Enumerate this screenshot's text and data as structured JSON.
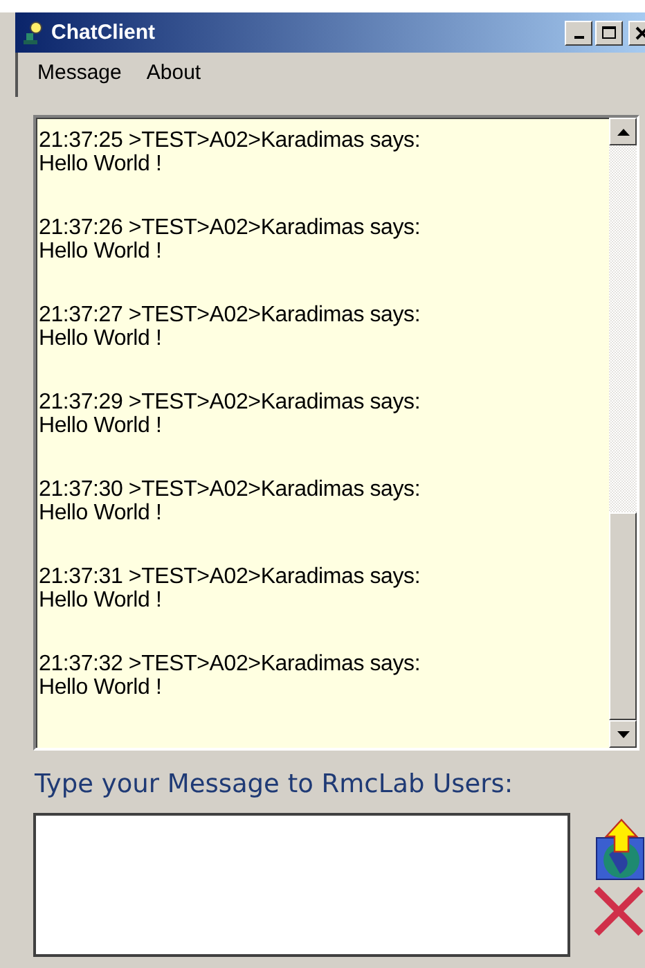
{
  "window": {
    "title": "ChatClient"
  },
  "menu": [
    "Message",
    "About"
  ],
  "messages": [
    {
      "header": "21:37:25 >TEST>A02>Karadimas says:",
      "text": "Hello World !"
    },
    {
      "header": "21:37:26 >TEST>A02>Karadimas says:",
      "text": "Hello World !"
    },
    {
      "header": "21:37:27 >TEST>A02>Karadimas says:",
      "text": "Hello World !"
    },
    {
      "header": "21:37:29 >TEST>A02>Karadimas says:",
      "text": "Hello World !"
    },
    {
      "header": "21:37:30 >TEST>A02>Karadimas says:",
      "text": "Hello World !"
    },
    {
      "header": "21:37:31 >TEST>A02>Karadimas says:",
      "text": "Hello World !"
    },
    {
      "header": "21:37:32 >TEST>A02>Karadimas says:",
      "text": "Hello World !"
    }
  ],
  "compose": {
    "label": "Type your Message to RmcLab Users:"
  }
}
